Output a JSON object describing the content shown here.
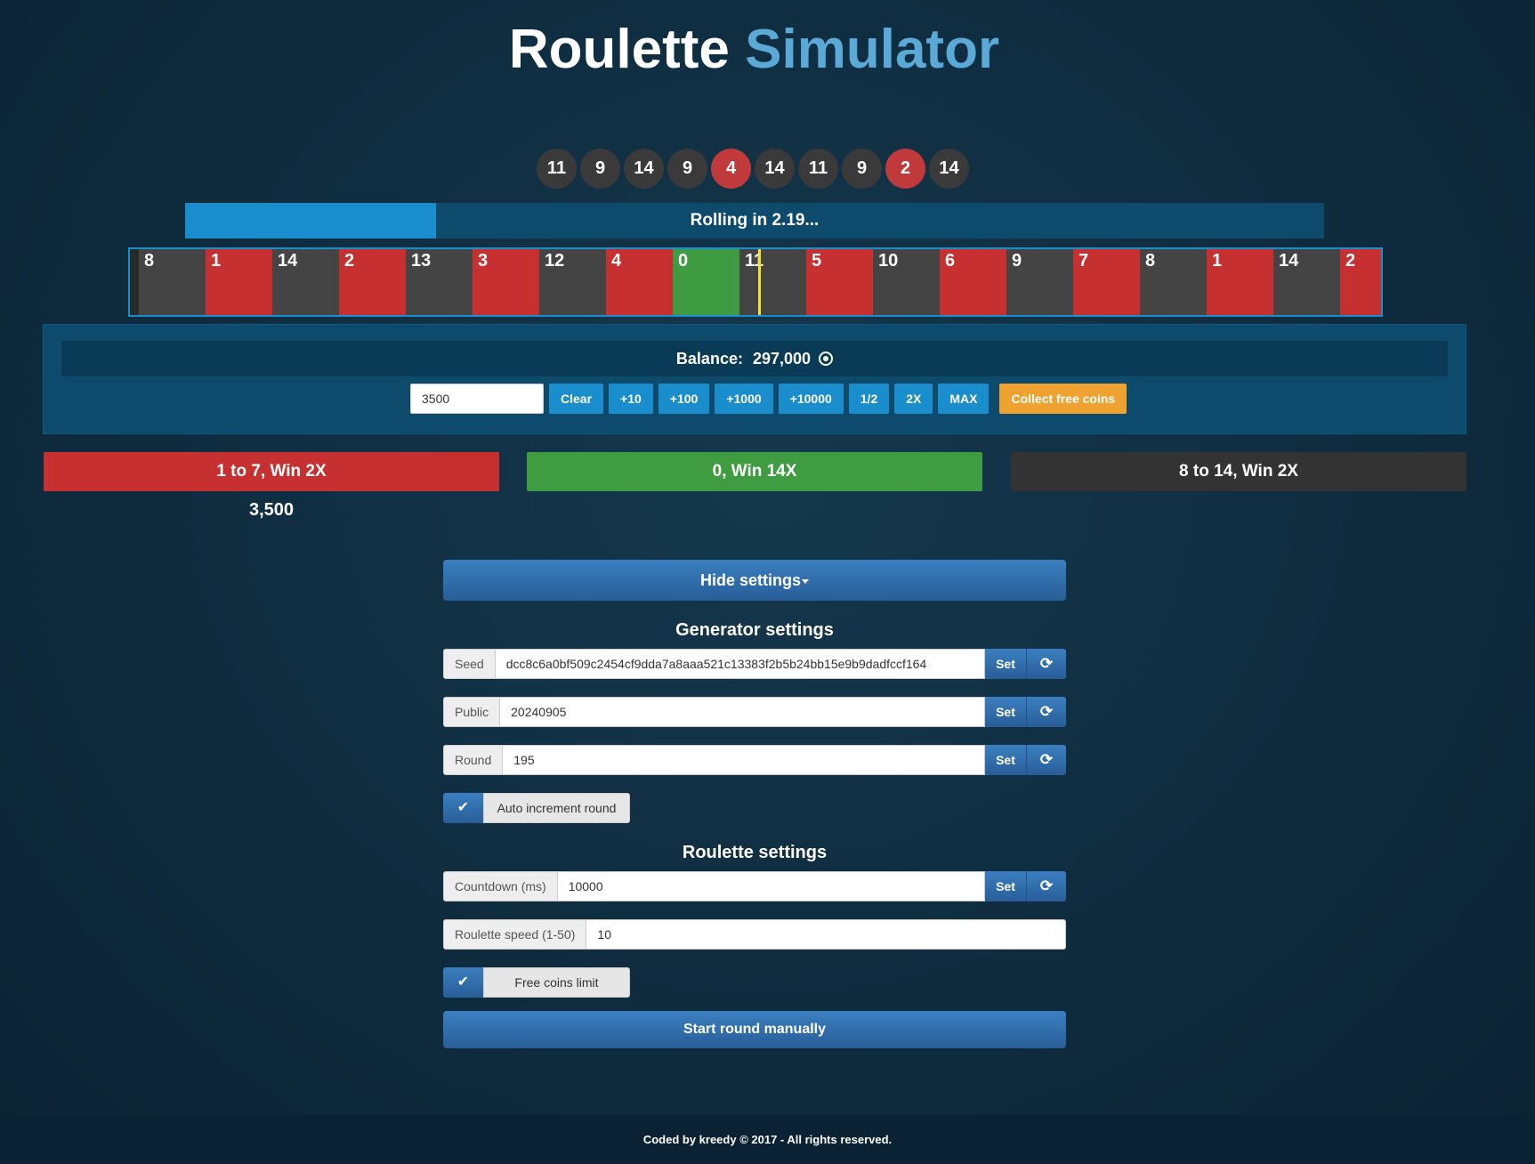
{
  "header": {
    "title_part1": "Roulette",
    "title_part2": "Simulator"
  },
  "history": [
    {
      "n": "11",
      "color": "black"
    },
    {
      "n": "9",
      "color": "black"
    },
    {
      "n": "14",
      "color": "black"
    },
    {
      "n": "9",
      "color": "black"
    },
    {
      "n": "4",
      "color": "red"
    },
    {
      "n": "14",
      "color": "black"
    },
    {
      "n": "11",
      "color": "black"
    },
    {
      "n": "9",
      "color": "black"
    },
    {
      "n": "2",
      "color": "red"
    },
    {
      "n": "14",
      "color": "black"
    }
  ],
  "progress": {
    "label": "Rolling in 2.19...",
    "fraction": 0.22
  },
  "wheel": [
    {
      "n": "8",
      "color": "black"
    },
    {
      "n": "1",
      "color": "red"
    },
    {
      "n": "14",
      "color": "black"
    },
    {
      "n": "2",
      "color": "red"
    },
    {
      "n": "13",
      "color": "black"
    },
    {
      "n": "3",
      "color": "red"
    },
    {
      "n": "12",
      "color": "black"
    },
    {
      "n": "4",
      "color": "red"
    },
    {
      "n": "0",
      "color": "green"
    },
    {
      "n": "11",
      "color": "black"
    },
    {
      "n": "5",
      "color": "red"
    },
    {
      "n": "10",
      "color": "black"
    },
    {
      "n": "6",
      "color": "red"
    },
    {
      "n": "9",
      "color": "black"
    },
    {
      "n": "7",
      "color": "red"
    },
    {
      "n": "8",
      "color": "black"
    },
    {
      "n": "1",
      "color": "red"
    },
    {
      "n": "14",
      "color": "black"
    },
    {
      "n": "2",
      "color": "red"
    }
  ],
  "balance": {
    "label": "Balance:",
    "value": "297,000"
  },
  "bet": {
    "amount_value": "3500",
    "buttons": [
      "Clear",
      "+10",
      "+100",
      "+1000",
      "+10000",
      "1/2",
      "2X",
      "MAX"
    ],
    "collect_label": "Collect free coins"
  },
  "bets": {
    "red_label": "1 to 7, Win 2X",
    "green_label": "0, Win 14X",
    "black_label": "8 to 14, Win 2X",
    "red_amount": "3,500"
  },
  "settings": {
    "toggle_label": "Hide settings",
    "generator_title": "Generator settings",
    "seed_label": "Seed",
    "seed_value": "dcc8c6a0bf509c2454cf9dda7a8aaa521c13383f2b5b24bb15e9b9dadfccf164",
    "public_label": "Public",
    "public_value": "20240905",
    "round_label": "Round",
    "round_value": "195",
    "set_label": "Set",
    "auto_increment_label": "Auto increment round",
    "roulette_title": "Roulette settings",
    "countdown_label": "Countdown (ms)",
    "countdown_value": "10000",
    "speed_label": "Roulette speed (1-50)",
    "speed_value": "10",
    "free_coins_label": "Free coins limit",
    "start_label": "Start round manually"
  },
  "footer": {
    "text": "Coded by kreedy © 2017 - All rights reserved."
  },
  "colors": {
    "red": "#c63030",
    "black": "#444444",
    "green": "#3e9b41",
    "accent": "#1a8dcc",
    "orange": "#f0a230"
  }
}
